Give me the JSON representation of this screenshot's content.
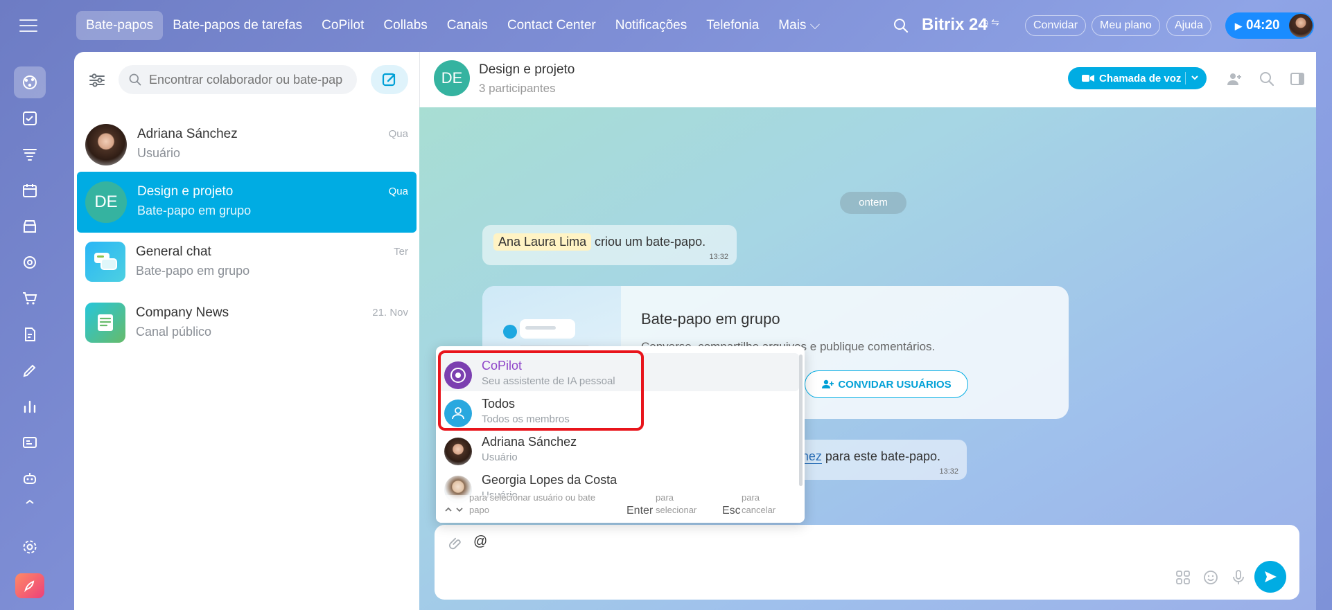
{
  "nav": {
    "items": [
      "Bate-papos",
      "Bate-papos de tarefas",
      "CoPilot",
      "Collabs",
      "Canais",
      "Contact Center",
      "Notificações",
      "Telefonia"
    ],
    "more": "Mais ⌵",
    "active_index": 0
  },
  "header": {
    "brand": "Bitrix",
    "brand_num": "24",
    "invite": "Convidar",
    "plan": "Meu plano",
    "help": "Ajuda",
    "timer": "04:20"
  },
  "sidebar_icons": [
    "chat-icon",
    "tasks-icon",
    "funnel-icon",
    "calendar-icon",
    "store-icon",
    "target-icon",
    "cart-icon",
    "document-sign-icon",
    "pen-icon",
    "analytics-icon",
    "id-card-icon",
    "robot-icon",
    "chevron-up-icon",
    "settings-icon",
    "rocket-icon"
  ],
  "chatlist": {
    "search_placeholder": "Encontrar colaborador ou bate-papo",
    "items": [
      {
        "name": "Adriana Sánchez",
        "sub": "Usuário",
        "date": "Qua"
      },
      {
        "name": "Design e projeto",
        "sub": "Bate-papo em grupo",
        "date": "Qua",
        "initials": "DE"
      },
      {
        "name": "General chat",
        "sub": "Bate-papo em grupo",
        "date": "Ter"
      },
      {
        "name": "Company News",
        "sub": "Canal público",
        "date": "21. Nov"
      }
    ]
  },
  "chat": {
    "initials": "DE",
    "title": "Design e projeto",
    "participants": "3 participantes",
    "call_label": "Chamada de voz",
    "date_chip": "ontem",
    "sys_author": "Ana Laura Lima",
    "sys_text": "criou um bate-papo.",
    "sys_time": "13:32",
    "welcome_title": "Bate-papo em grupo",
    "welcome_desc": "Converse, compartilhe arquivos e publique comentários.",
    "invite_label": "CONVIDAR USUÁRIOS",
    "add_link": "driana Sánchez",
    "add_text": " para este bate-papo.",
    "add_time": "13:32",
    "input_value": "@"
  },
  "mention_popup": {
    "items": [
      {
        "name": "CoPilot",
        "sub": "Seu assistente de IA pessoal"
      },
      {
        "name": "Todos",
        "sub": "Todos os membros"
      },
      {
        "name": "Adriana Sánchez",
        "sub": "Usuário"
      },
      {
        "name": "Georgia Lopes da Costa",
        "sub": "Usuário"
      }
    ],
    "hint_nav_l1": "para selecionar usuário ou bate",
    "hint_nav_l2": "papo",
    "hint_enter_key": "Enter",
    "hint_enter_l1": "para",
    "hint_enter_l2": "selecionar",
    "hint_esc_key": "Esc",
    "hint_esc_l1": "para",
    "hint_esc_l2": "cancelar"
  },
  "colors": {
    "accent": "#00ace3",
    "highlight": "#e8141b",
    "copilot": "#8e44c9"
  }
}
